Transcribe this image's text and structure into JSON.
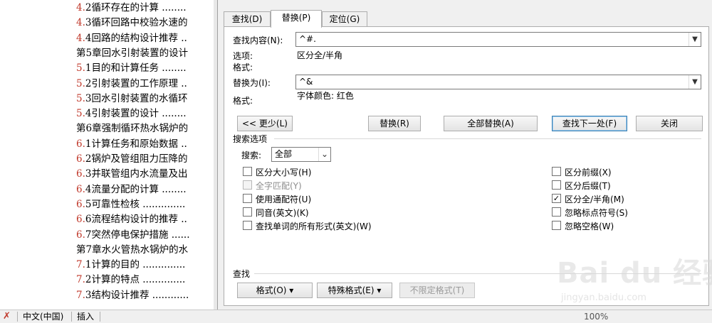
{
  "document": {
    "toc": [
      {
        "num": "4.",
        "text": "2循环存在的计算 ........",
        "type": "item"
      },
      {
        "num": "4.",
        "text": "3循环回路中校验水速的",
        "type": "item"
      },
      {
        "num": "4.",
        "text": "4回路的结构设计推荐 ..",
        "type": "item"
      },
      {
        "num": "",
        "text": "第5章回水引射装置的设计",
        "type": "chapter"
      },
      {
        "num": "5.",
        "text": "1目的和计算任务 ........",
        "type": "item"
      },
      {
        "num": "5.",
        "text": "2引射装置的工作原理 ..",
        "type": "item"
      },
      {
        "num": "5.",
        "text": "3回水引射装置的水循环",
        "type": "item"
      },
      {
        "num": "5.",
        "text": "4引射装置的设计 ........",
        "type": "item"
      },
      {
        "num": "",
        "text": "第6章强制循环热水锅炉的",
        "type": "chapter"
      },
      {
        "num": "6.",
        "text": "1计算任务和原始数据 ..",
        "type": "item"
      },
      {
        "num": "6.",
        "text": "2锅炉及管组阻力压降的",
        "type": "item"
      },
      {
        "num": "6.",
        "text": "3并联管组内水流量及出",
        "type": "item"
      },
      {
        "num": "6.",
        "text": "4流量分配的计算 ........",
        "type": "item"
      },
      {
        "num": "6.",
        "text": "5可靠性检核 ..............",
        "type": "item"
      },
      {
        "num": "6.",
        "text": "6流程结构设计的推荐 ..",
        "type": "item"
      },
      {
        "num": "6.",
        "text": "7突然停电保护措施 ......",
        "type": "item"
      },
      {
        "num": "",
        "text": "第7章水火管热水锅炉的水",
        "type": "chapter"
      },
      {
        "num": "7.",
        "text": "1计算的目的 ..............",
        "type": "item"
      },
      {
        "num": "7.",
        "text": "2计算的特点 ..............",
        "type": "item"
      },
      {
        "num": "7.",
        "text": "3结构设计推荐 ............",
        "type": "item"
      }
    ]
  },
  "statusbar": {
    "language": "中文(中国)",
    "mode": "插入",
    "zoom": "100%"
  },
  "dialog": {
    "tabs": [
      {
        "label": "查找(D)",
        "active": false
      },
      {
        "label": "替换(P)",
        "active": true
      },
      {
        "label": "定位(G)",
        "active": false
      }
    ],
    "find": {
      "label": "查找内容(N):",
      "value": "^#.",
      "options_label": "选项:",
      "options_value": "区分全/半角",
      "format_label": "格式:"
    },
    "replace": {
      "label": "替换为(I):",
      "value": "^&",
      "format_label": "格式:",
      "format_value": "字体颜色: 红色"
    },
    "buttons": {
      "less": "<< 更少(L)",
      "replace": "替换(R)",
      "replace_all": "全部替换(A)",
      "find_next": "查找下一处(F)",
      "close": "关闭"
    },
    "search_options": {
      "title": "搜索选项",
      "search_label": "搜索:",
      "search_value": "全部"
    },
    "checkboxes_left": [
      {
        "label": "区分大小写(H)",
        "checked": false,
        "disabled": false
      },
      {
        "label": "全字匹配(Y)",
        "checked": false,
        "disabled": true
      },
      {
        "label": "使用通配符(U)",
        "checked": false,
        "disabled": false
      },
      {
        "label": "同音(英文)(K)",
        "checked": false,
        "disabled": false
      },
      {
        "label": "查找单词的所有形式(英文)(W)",
        "checked": false,
        "disabled": false
      }
    ],
    "checkboxes_right": [
      {
        "label": "区分前缀(X)",
        "checked": false,
        "disabled": false
      },
      {
        "label": "区分后缀(T)",
        "checked": false,
        "disabled": false
      },
      {
        "label": "区分全/半角(M)",
        "checked": true,
        "disabled": false
      },
      {
        "label": "忽略标点符号(S)",
        "checked": false,
        "disabled": false
      },
      {
        "label": "忽略空格(W)",
        "checked": false,
        "disabled": false
      }
    ],
    "bottom": {
      "title": "查找",
      "format_btn": "格式(O) ▾",
      "special_btn": "特殊格式(E) ▾",
      "no_format_btn": "不限定格式(T)"
    }
  },
  "watermark": {
    "logo": "Bai du 经验",
    "url": "jingyan.baidu.com"
  }
}
